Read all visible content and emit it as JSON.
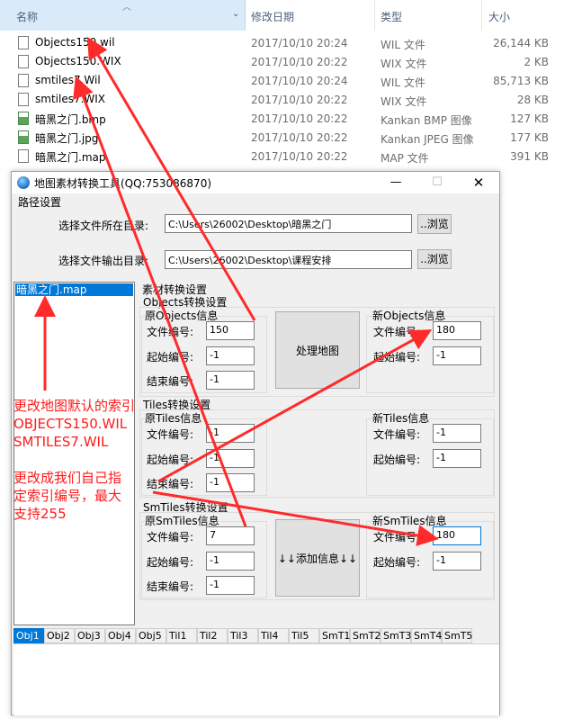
{
  "explorer": {
    "columns": {
      "name": "名称",
      "date": "修改日期",
      "type": "类型",
      "size": "大小"
    },
    "files": [
      {
        "name": "Objects150.wil",
        "date": "2017/10/10 20:24",
        "type": "WIL 文件",
        "size": "26,144 KB",
        "icon": "file-icon"
      },
      {
        "name": "Objects150.WIX",
        "date": "2017/10/10 20:22",
        "type": "WIX 文件",
        "size": "2 KB",
        "icon": "file-icon"
      },
      {
        "name": "smtiles7.Wil",
        "date": "2017/10/10 20:24",
        "type": "WIL 文件",
        "size": "85,713 KB",
        "icon": "file-icon"
      },
      {
        "name": "smtiles7.WIX",
        "date": "2017/10/10 20:22",
        "type": "WIX 文件",
        "size": "28 KB",
        "icon": "file-icon"
      },
      {
        "name": "暗黑之门.bmp",
        "date": "2017/10/10 20:22",
        "type": "Kankan BMP 图像",
        "size": "127 KB",
        "icon": "image-icon"
      },
      {
        "name": "暗黑之门.jpg",
        "date": "2017/10/10 20:22",
        "type": "Kankan JPEG 图像",
        "size": "177 KB",
        "icon": "image-icon"
      },
      {
        "name": "暗黑之门.map",
        "date": "2017/10/10 20:22",
        "type": "MAP 文件",
        "size": "391 KB",
        "icon": "file-icon"
      }
    ]
  },
  "window": {
    "title": "地图素材转换工具(QQ:753086870)",
    "controls": {
      "minimize": "—",
      "maximize": "☐",
      "close": "✕"
    }
  },
  "path_settings": {
    "group_label": "路径设置",
    "input_dir_label": "选择文件所在目录:",
    "input_dir_value": "C:\\Users\\26002\\Desktop\\暗黑之门",
    "output_dir_label": "选择文件输出目录:",
    "output_dir_value": "C:\\Users\\26002\\Desktop\\课程安排",
    "browse_label": "..浏览"
  },
  "map_list": {
    "items": [
      "暗黑之门.map"
    ],
    "selected_index": 0
  },
  "annotation": {
    "lines": [
      "更改地图默认的索引",
      "OBJECTS150.WIL",
      "SMTILES7.WIL",
      "",
      "更改成我们自己指",
      "定索引编号，最大",
      "支持255"
    ],
    "color": "#ff1a1a"
  },
  "conversion": {
    "group_label": "素材转换设置",
    "objects": {
      "group_label": "Objects转换设置",
      "orig_label": "原Objects信息",
      "new_label": "新Objects信息",
      "file_no_label": "文件编号:",
      "start_label": "起始编号:",
      "end_label": "结束编号:",
      "orig_file_no": "150",
      "orig_start": "-1",
      "orig_end": "-1",
      "new_file_no": "180",
      "new_start": "-1"
    },
    "tiles": {
      "group_label": "Tiles转换设置",
      "orig_label": "原Tiles信息",
      "new_label": "新Tiles信息",
      "file_no_label": "文件编号:",
      "start_label": "起始编号:",
      "end_label": "结束编号:",
      "orig_file_no": "-1",
      "orig_start": "-1",
      "orig_end": "-1",
      "new_file_no": "-1",
      "new_start": "-1"
    },
    "smtiles": {
      "group_label": "SmTiles转换设置",
      "orig_label": "原SmTiles信息",
      "new_label": "新SmTiles信息",
      "file_no_label": "文件编号:",
      "start_label": "起始编号:",
      "end_label": "结束编号:",
      "orig_file_no": "7",
      "orig_start": "-1",
      "orig_end": "-1",
      "new_file_no": "180",
      "new_start": "-1"
    },
    "process_map_label": "处理地图",
    "add_info_label": "↓↓添加信息↓↓"
  },
  "tabs": [
    "Obj1",
    "Obj2",
    "Obj3",
    "Obj4",
    "Obj5",
    "Til1",
    "Til2",
    "Til3",
    "Til4",
    "Til5",
    "SmT1",
    "SmT2",
    "SmT3",
    "SmT4",
    "SmT5"
  ],
  "active_tab_index": 0
}
